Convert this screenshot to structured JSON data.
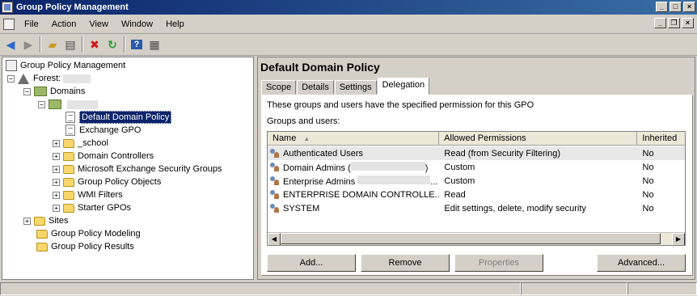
{
  "window": {
    "title": "Group Policy Management"
  },
  "menu": [
    "File",
    "Action",
    "View",
    "Window",
    "Help"
  ],
  "toolbar": {
    "back_icon": "back-arrow-icon",
    "forward_icon": "forward-arrow-icon",
    "up_icon": "up-folder-icon",
    "show_hide_icon": "show-hide-tree-icon",
    "delete_icon": "delete-icon",
    "refresh_icon": "refresh-icon",
    "help_icon": "help-icon",
    "properties_icon": "properties-icon"
  },
  "tree": {
    "root": "Group Policy Management",
    "forest_label": "Forest:",
    "domains_label": "Domains",
    "items": [
      "Default Domain Policy",
      "Exchange GPO",
      "_school",
      "Domain Controllers",
      "Microsoft Exchange Security Groups",
      "Group Policy Objects",
      "WMI Filters",
      "Starter GPOs"
    ],
    "sites": "Sites",
    "modeling": "Group Policy Modeling",
    "results": "Group Policy Results"
  },
  "details": {
    "title": "Default Domain Policy",
    "tabs": [
      "Scope",
      "Details",
      "Settings",
      "Delegation"
    ],
    "active_tab": "Delegation",
    "description": "These groups and users have the specified permission for this GPO",
    "groups_label": "Groups and users:",
    "columns": [
      "Name",
      "Allowed Permissions",
      "Inherited"
    ],
    "rows": [
      {
        "name": "Authenticated Users",
        "perm": "Read (from Security Filtering)",
        "inherited": "No"
      },
      {
        "name": "Domain Admins (",
        "name_suffix": ")",
        "perm": "Custom",
        "inherited": "No"
      },
      {
        "name": "Enterprise Admins",
        "name_suffix": "...",
        "perm": "Custom",
        "inherited": "No"
      },
      {
        "name": "ENTERPRISE DOMAIN CONTROLLE...",
        "perm": "Read",
        "inherited": "No"
      },
      {
        "name": "SYSTEM",
        "perm": "Edit settings, delete, modify security",
        "inherited": "No"
      }
    ],
    "buttons": {
      "add": "Add...",
      "remove": "Remove",
      "properties": "Properties",
      "advanced": "Advanced..."
    }
  }
}
